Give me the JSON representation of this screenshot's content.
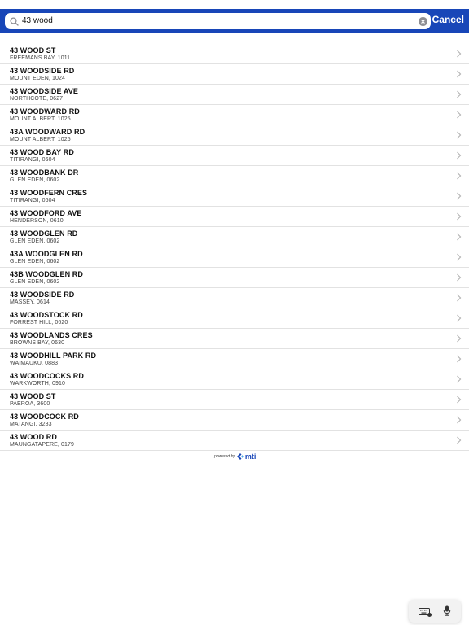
{
  "search": {
    "value": "43 wood",
    "placeholder": "",
    "cancel_label": "Cancel"
  },
  "results": [
    {
      "street": "43 WOOD ST",
      "suburb": "FREEMANS BAY, 1011"
    },
    {
      "street": "43 WOODSIDE RD",
      "suburb": "MOUNT EDEN, 1024"
    },
    {
      "street": "43 WOODSIDE AVE",
      "suburb": "NORTHCOTE, 0627"
    },
    {
      "street": "43 WOODWARD RD",
      "suburb": "MOUNT ALBERT, 1025"
    },
    {
      "street": "43A WOODWARD RD",
      "suburb": "MOUNT ALBERT, 1025"
    },
    {
      "street": "43 WOOD BAY RD",
      "suburb": "TITIRANGI, 0604"
    },
    {
      "street": "43 WOODBANK DR",
      "suburb": "GLEN EDEN, 0602"
    },
    {
      "street": "43 WOODFERN CRES",
      "suburb": "TITIRANGI, 0604"
    },
    {
      "street": "43 WOODFORD AVE",
      "suburb": "HENDERSON, 0610"
    },
    {
      "street": "43 WOODGLEN RD",
      "suburb": "GLEN EDEN, 0602"
    },
    {
      "street": "43A WOODGLEN RD",
      "suburb": "GLEN EDEN, 0602"
    },
    {
      "street": "43B WOODGLEN RD",
      "suburb": "GLEN EDEN, 0602"
    },
    {
      "street": "43 WOODSIDE RD",
      "suburb": "MASSEY, 0614"
    },
    {
      "street": "43 WOODSTOCK RD",
      "suburb": "FORREST HILL, 0620"
    },
    {
      "street": "43 WOODLANDS CRES",
      "suburb": "BROWNS BAY, 0630"
    },
    {
      "street": "43 WOODHILL PARK RD",
      "suburb": "WAIMAUKU, 0883"
    },
    {
      "street": "43 WOODCOCKS RD",
      "suburb": "WARKWORTH, 0910"
    },
    {
      "street": "43 WOOD ST",
      "suburb": "PAEROA, 3600"
    },
    {
      "street": "43 WOODCOCK RD",
      "suburb": "MATANGI, 3283"
    },
    {
      "street": "43 WOOD RD",
      "suburb": "MAUNGATAPERE, 0179"
    }
  ],
  "footer": {
    "powered_by": "powered by",
    "brand": "mti"
  },
  "icons": {
    "search": "search-icon",
    "clear": "clear-icon",
    "chevron": "chevron-right-icon",
    "keyboard": "keyboard-icon",
    "microphone": "microphone-icon"
  },
  "colors": {
    "header_blue": "#1846b8",
    "divider": "#e2e2e2"
  }
}
